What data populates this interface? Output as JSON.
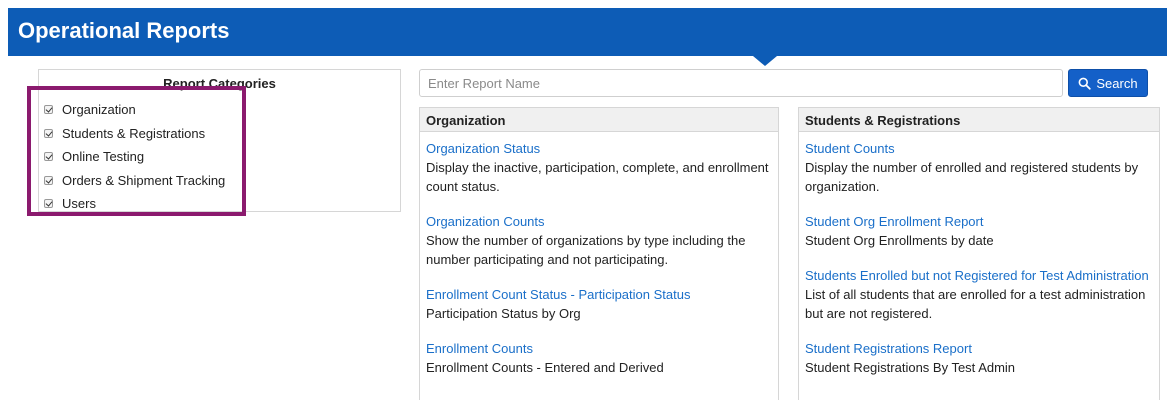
{
  "header": {
    "title": "Operational Reports"
  },
  "categories": {
    "heading": "Report Categories",
    "items": [
      {
        "label": "Organization",
        "checked": true
      },
      {
        "label": "Students & Registrations",
        "checked": true
      },
      {
        "label": "Online Testing",
        "checked": true
      },
      {
        "label": "Orders & Shipment Tracking",
        "checked": true
      },
      {
        "label": "Users",
        "checked": true
      }
    ],
    "highlight_color": "#8b1a6e"
  },
  "search": {
    "placeholder": "Enter Report Name",
    "value": "",
    "button_label": "Search"
  },
  "columns": [
    {
      "title": "Organization",
      "reports": [
        {
          "name": "Organization Status",
          "description": "Display the inactive, participation, complete, and enrollment count status."
        },
        {
          "name": "Organization Counts",
          "description": "Show the number of organizations by type including the number participating and not participating."
        },
        {
          "name": "Enrollment Count Status - Participation Status",
          "description": "Participation Status by Org"
        },
        {
          "name": "Enrollment Counts",
          "description": "Enrollment Counts - Entered and Derived"
        }
      ]
    },
    {
      "title": "Students & Registrations",
      "reports": [
        {
          "name": "Student Counts",
          "description": "Display the number of enrolled and registered students by organization."
        },
        {
          "name": "Student Org Enrollment Report",
          "description": "Student Org Enrollments by date"
        },
        {
          "name": "Students Enrolled but not Registered for Test Administration",
          "description": "List of all students that are enrolled for a test administration but are not registered."
        },
        {
          "name": "Student Registrations Report",
          "description": "Student Registrations By Test Admin"
        }
      ]
    }
  ],
  "colors": {
    "header_bg": "#0d5cb6",
    "link": "#1a6fc9",
    "button_bg": "#1460c8"
  },
  "icons": {
    "search_button": "search-icon",
    "category_checkbox": "checkbox-checked-icon"
  }
}
